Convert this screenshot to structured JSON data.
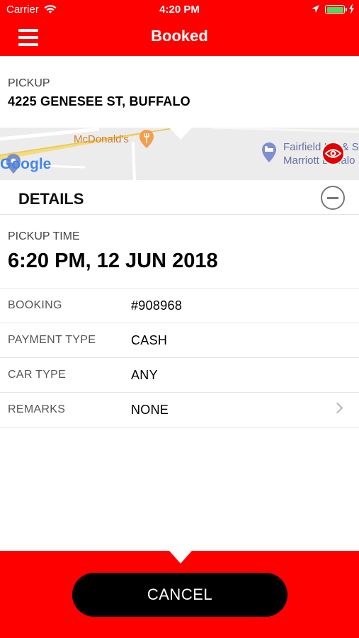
{
  "status_bar": {
    "carrier": "Carrier",
    "time": "4:20 PM",
    "battery_level": 1.0,
    "battery_color": "#4cd964"
  },
  "nav": {
    "title": "Booked",
    "menu_icon": "hamburger-menu-icon",
    "bar_color": "#ff0000"
  },
  "pickup": {
    "label": "PICKUP",
    "address": "4225 GENESEE ST, BUFFALO"
  },
  "map": {
    "poi_label": "McDonald's",
    "hotel_label_line1": "Fairfield Inn & Suites",
    "hotel_label_line2": "Marriott Buffalo",
    "attribution": "Google",
    "eye_icon": "eye-icon"
  },
  "details": {
    "title": "DETAILS",
    "collapse_icon": "minus-circle-icon",
    "pickup_time_label": "PICKUP TIME",
    "pickup_time_value": "6:20 PM, 12 JUN 2018",
    "rows": [
      {
        "label": "BOOKING",
        "value": "#908968"
      },
      {
        "label": "PAYMENT TYPE",
        "value": "CASH"
      },
      {
        "label": "CAR TYPE",
        "value": "ANY"
      },
      {
        "label": "REMARKS",
        "value": "NONE"
      }
    ]
  },
  "footer": {
    "cancel_label": "CANCEL",
    "footer_color": "#ff0000"
  }
}
